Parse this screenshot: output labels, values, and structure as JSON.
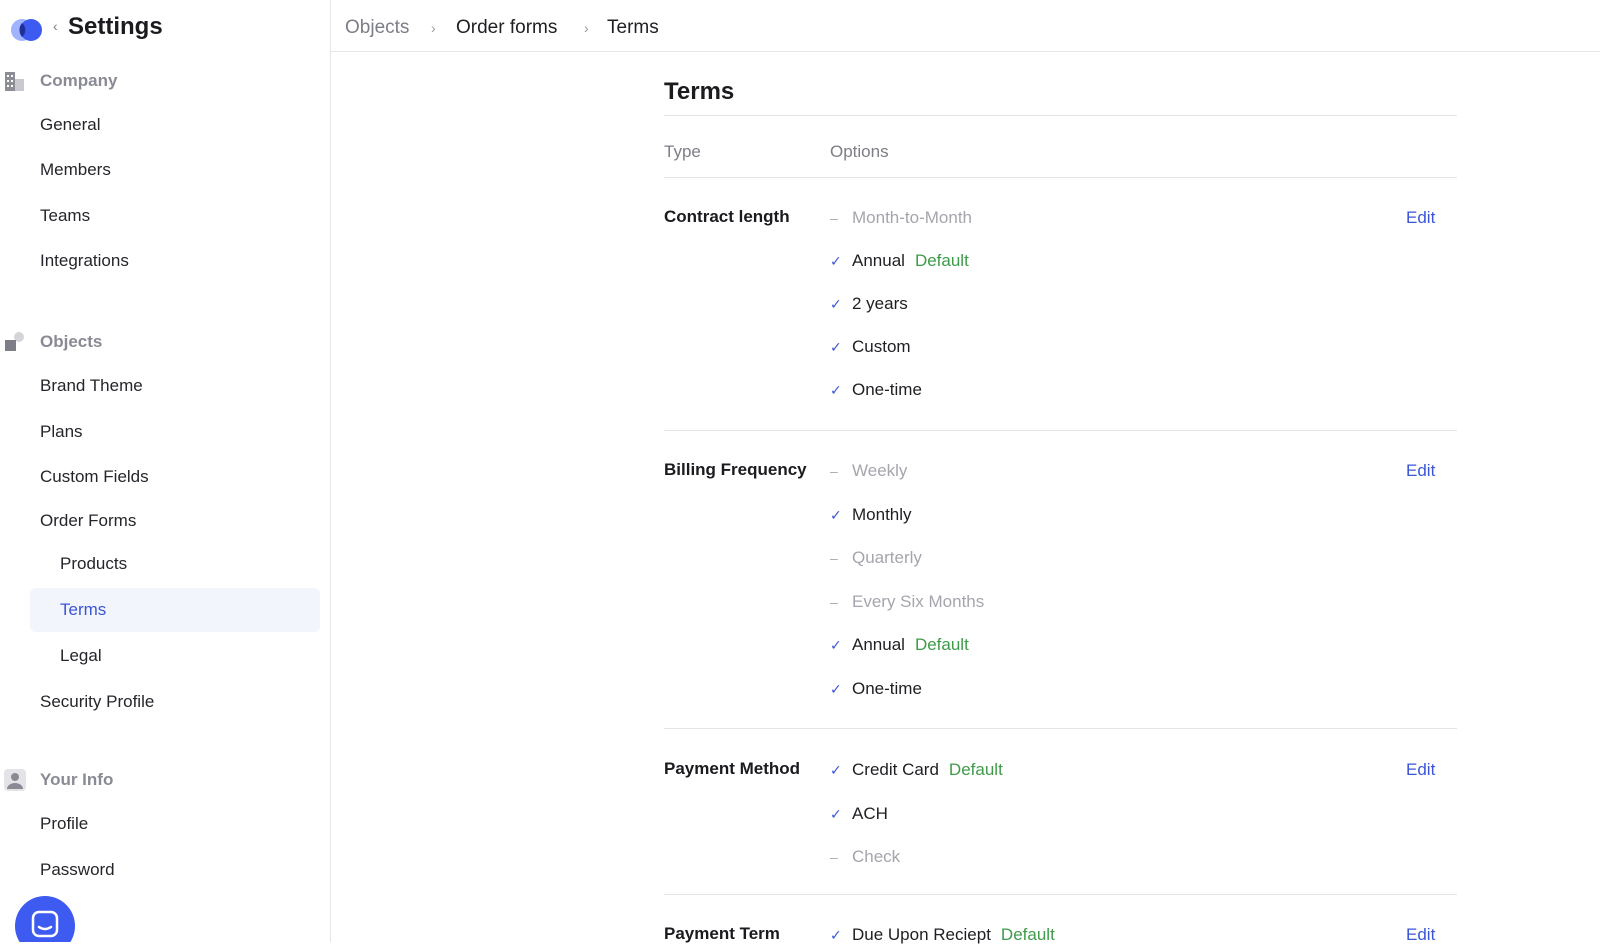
{
  "app": {
    "title": "Settings"
  },
  "colors": {
    "accent": "#3a55d8",
    "default_green": "#3f9a4a",
    "muted": "#a5a5ad"
  },
  "sidebar": {
    "sections": [
      {
        "label": "Company",
        "icon": "building-icon",
        "items": [
          "General",
          "Members",
          "Teams",
          "Integrations"
        ]
      },
      {
        "label": "Objects",
        "icon": "objects-icon",
        "items": [
          "Brand Theme",
          "Plans",
          "Custom Fields",
          "Order Forms",
          "Products",
          "Terms",
          "Legal",
          "Security Profile"
        ]
      },
      {
        "label": "Your Info",
        "icon": "user-icon",
        "items": [
          "Profile",
          "Password"
        ]
      }
    ],
    "active_item": "Terms"
  },
  "breadcrumb": [
    "Objects",
    "Order forms",
    "Terms"
  ],
  "page": {
    "title": "Terms",
    "columns": [
      "Type",
      "Options"
    ],
    "edit_label": "Edit",
    "default_label": "Default",
    "groups": [
      {
        "type": "Contract length",
        "options": [
          {
            "label": "Month-to-Month",
            "enabled": false,
            "default": false
          },
          {
            "label": "Annual",
            "enabled": true,
            "default": true
          },
          {
            "label": "2 years",
            "enabled": true,
            "default": false
          },
          {
            "label": "Custom",
            "enabled": true,
            "default": false
          },
          {
            "label": "One-time",
            "enabled": true,
            "default": false
          }
        ]
      },
      {
        "type": "Billing Frequency",
        "options": [
          {
            "label": "Weekly",
            "enabled": false,
            "default": false
          },
          {
            "label": "Monthly",
            "enabled": true,
            "default": false
          },
          {
            "label": "Quarterly",
            "enabled": false,
            "default": false
          },
          {
            "label": "Every Six Months",
            "enabled": false,
            "default": false
          },
          {
            "label": "Annual",
            "enabled": true,
            "default": true
          },
          {
            "label": "One-time",
            "enabled": true,
            "default": false
          }
        ]
      },
      {
        "type": "Payment Method",
        "options": [
          {
            "label": "Credit Card",
            "enabled": true,
            "default": true
          },
          {
            "label": "ACH",
            "enabled": true,
            "default": false
          },
          {
            "label": "Check",
            "enabled": false,
            "default": false
          }
        ]
      },
      {
        "type": "Payment Term",
        "options": [
          {
            "label": "Due Upon Reciept",
            "enabled": true,
            "default": true
          }
        ]
      }
    ]
  }
}
